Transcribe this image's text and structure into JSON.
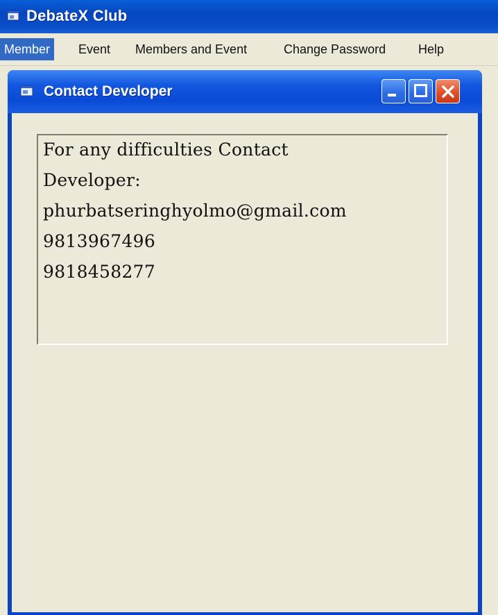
{
  "app": {
    "title": "DebateX Club"
  },
  "menu": {
    "items": [
      {
        "label": "Member",
        "active": true
      },
      {
        "label": "Event"
      },
      {
        "label": "Members and Event"
      },
      {
        "label": "Change Password"
      },
      {
        "label": "Help"
      }
    ]
  },
  "window": {
    "title": "Contact Developer",
    "icons": {
      "minimize": "minimize-icon",
      "maximize": "maximize-icon",
      "close": "close-icon"
    }
  },
  "contact": {
    "lines": [
      "For any difficulties Contact",
      "Developer:",
      "phurbatseringhyolmo@gmail.com",
      "9813967496",
      "9818458277"
    ]
  },
  "colors": {
    "titlebar": "#0a4ec8",
    "menu_highlight": "#316ac5",
    "client_bg": "#ece9d8",
    "close_button": "#e0502a"
  }
}
